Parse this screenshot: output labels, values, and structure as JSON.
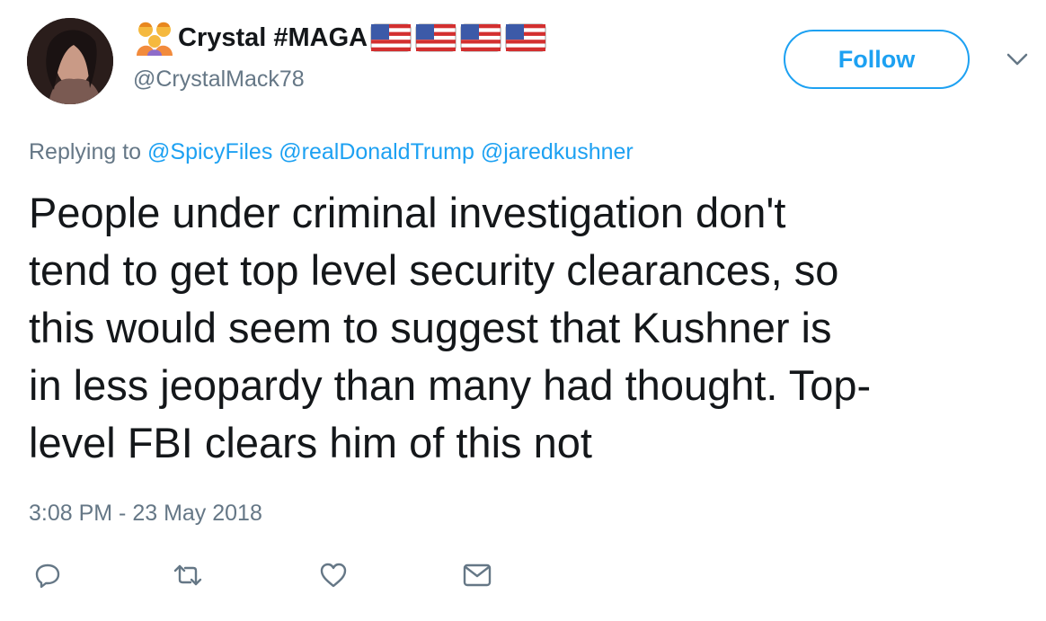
{
  "author": {
    "display_name": "Crystal #MAGA",
    "handle": "@CrystalMack78",
    "emoji_icon": "family-emoji-icon",
    "flag_icon": "us-flag-icon",
    "flag_count": 4
  },
  "follow_button": {
    "label": "Follow"
  },
  "menu_icon": "chevron-down-icon",
  "reply_context": {
    "prefix": "Replying to",
    "mentions": [
      "@SpicyFiles",
      "@realDonaldTrump",
      "@jaredkushner"
    ]
  },
  "tweet": {
    "lines": [
      "People under criminal investigation don't",
      "tend to get top level security clearances, so",
      "this would seem to suggest that Kushner is",
      "in less jeopardy than many had thought. Top-",
      "level FBI clears him of this not"
    ],
    "timestamp": "3:08 PM - 23 May 2018"
  },
  "actions": [
    "reply-icon",
    "retweet-icon",
    "like-icon",
    "direct-message-icon"
  ],
  "colors": {
    "accent": "#1da1f2",
    "text": "#14171a",
    "secondary": "#657786",
    "icon": "#657786",
    "flag_red": "#d32f2f",
    "flag_blue": "#3c5aa8"
  }
}
